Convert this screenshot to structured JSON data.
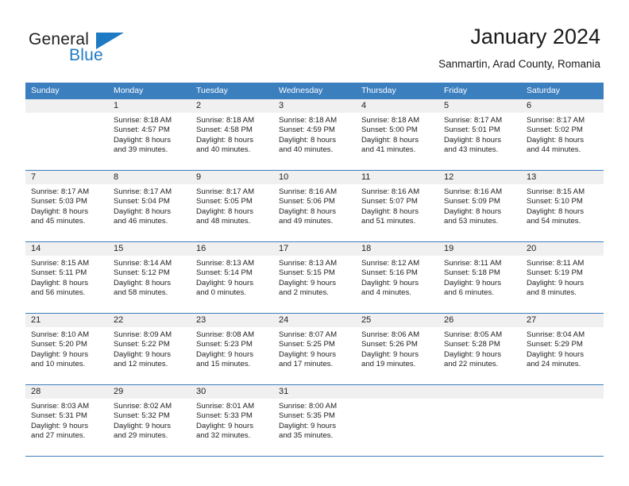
{
  "brand": {
    "name_part1": "General",
    "name_part2": "Blue"
  },
  "header": {
    "title": "January 2024",
    "subtitle": "Sanmartin, Arad County, Romania"
  },
  "colors": {
    "header_blue": "#3c7fbf",
    "brand_blue": "#1f7ac4",
    "daynum_band": "#f0f0f0",
    "text": "#222222"
  },
  "weekdays": [
    "Sunday",
    "Monday",
    "Tuesday",
    "Wednesday",
    "Thursday",
    "Friday",
    "Saturday"
  ],
  "weeks": [
    [
      {
        "day": "",
        "sunrise": "",
        "sunset": "",
        "daylight_line1": "",
        "daylight_line2": ""
      },
      {
        "day": "1",
        "sunrise": "Sunrise: 8:18 AM",
        "sunset": "Sunset: 4:57 PM",
        "daylight_line1": "Daylight: 8 hours",
        "daylight_line2": "and 39 minutes."
      },
      {
        "day": "2",
        "sunrise": "Sunrise: 8:18 AM",
        "sunset": "Sunset: 4:58 PM",
        "daylight_line1": "Daylight: 8 hours",
        "daylight_line2": "and 40 minutes."
      },
      {
        "day": "3",
        "sunrise": "Sunrise: 8:18 AM",
        "sunset": "Sunset: 4:59 PM",
        "daylight_line1": "Daylight: 8 hours",
        "daylight_line2": "and 40 minutes."
      },
      {
        "day": "4",
        "sunrise": "Sunrise: 8:18 AM",
        "sunset": "Sunset: 5:00 PM",
        "daylight_line1": "Daylight: 8 hours",
        "daylight_line2": "and 41 minutes."
      },
      {
        "day": "5",
        "sunrise": "Sunrise: 8:17 AM",
        "sunset": "Sunset: 5:01 PM",
        "daylight_line1": "Daylight: 8 hours",
        "daylight_line2": "and 43 minutes."
      },
      {
        "day": "6",
        "sunrise": "Sunrise: 8:17 AM",
        "sunset": "Sunset: 5:02 PM",
        "daylight_line1": "Daylight: 8 hours",
        "daylight_line2": "and 44 minutes."
      }
    ],
    [
      {
        "day": "7",
        "sunrise": "Sunrise: 8:17 AM",
        "sunset": "Sunset: 5:03 PM",
        "daylight_line1": "Daylight: 8 hours",
        "daylight_line2": "and 45 minutes."
      },
      {
        "day": "8",
        "sunrise": "Sunrise: 8:17 AM",
        "sunset": "Sunset: 5:04 PM",
        "daylight_line1": "Daylight: 8 hours",
        "daylight_line2": "and 46 minutes."
      },
      {
        "day": "9",
        "sunrise": "Sunrise: 8:17 AM",
        "sunset": "Sunset: 5:05 PM",
        "daylight_line1": "Daylight: 8 hours",
        "daylight_line2": "and 48 minutes."
      },
      {
        "day": "10",
        "sunrise": "Sunrise: 8:16 AM",
        "sunset": "Sunset: 5:06 PM",
        "daylight_line1": "Daylight: 8 hours",
        "daylight_line2": "and 49 minutes."
      },
      {
        "day": "11",
        "sunrise": "Sunrise: 8:16 AM",
        "sunset": "Sunset: 5:07 PM",
        "daylight_line1": "Daylight: 8 hours",
        "daylight_line2": "and 51 minutes."
      },
      {
        "day": "12",
        "sunrise": "Sunrise: 8:16 AM",
        "sunset": "Sunset: 5:09 PM",
        "daylight_line1": "Daylight: 8 hours",
        "daylight_line2": "and 53 minutes."
      },
      {
        "day": "13",
        "sunrise": "Sunrise: 8:15 AM",
        "sunset": "Sunset: 5:10 PM",
        "daylight_line1": "Daylight: 8 hours",
        "daylight_line2": "and 54 minutes."
      }
    ],
    [
      {
        "day": "14",
        "sunrise": "Sunrise: 8:15 AM",
        "sunset": "Sunset: 5:11 PM",
        "daylight_line1": "Daylight: 8 hours",
        "daylight_line2": "and 56 minutes."
      },
      {
        "day": "15",
        "sunrise": "Sunrise: 8:14 AM",
        "sunset": "Sunset: 5:12 PM",
        "daylight_line1": "Daylight: 8 hours",
        "daylight_line2": "and 58 minutes."
      },
      {
        "day": "16",
        "sunrise": "Sunrise: 8:13 AM",
        "sunset": "Sunset: 5:14 PM",
        "daylight_line1": "Daylight: 9 hours",
        "daylight_line2": "and 0 minutes."
      },
      {
        "day": "17",
        "sunrise": "Sunrise: 8:13 AM",
        "sunset": "Sunset: 5:15 PM",
        "daylight_line1": "Daylight: 9 hours",
        "daylight_line2": "and 2 minutes."
      },
      {
        "day": "18",
        "sunrise": "Sunrise: 8:12 AM",
        "sunset": "Sunset: 5:16 PM",
        "daylight_line1": "Daylight: 9 hours",
        "daylight_line2": "and 4 minutes."
      },
      {
        "day": "19",
        "sunrise": "Sunrise: 8:11 AM",
        "sunset": "Sunset: 5:18 PM",
        "daylight_line1": "Daylight: 9 hours",
        "daylight_line2": "and 6 minutes."
      },
      {
        "day": "20",
        "sunrise": "Sunrise: 8:11 AM",
        "sunset": "Sunset: 5:19 PM",
        "daylight_line1": "Daylight: 9 hours",
        "daylight_line2": "and 8 minutes."
      }
    ],
    [
      {
        "day": "21",
        "sunrise": "Sunrise: 8:10 AM",
        "sunset": "Sunset: 5:20 PM",
        "daylight_line1": "Daylight: 9 hours",
        "daylight_line2": "and 10 minutes."
      },
      {
        "day": "22",
        "sunrise": "Sunrise: 8:09 AM",
        "sunset": "Sunset: 5:22 PM",
        "daylight_line1": "Daylight: 9 hours",
        "daylight_line2": "and 12 minutes."
      },
      {
        "day": "23",
        "sunrise": "Sunrise: 8:08 AM",
        "sunset": "Sunset: 5:23 PM",
        "daylight_line1": "Daylight: 9 hours",
        "daylight_line2": "and 15 minutes."
      },
      {
        "day": "24",
        "sunrise": "Sunrise: 8:07 AM",
        "sunset": "Sunset: 5:25 PM",
        "daylight_line1": "Daylight: 9 hours",
        "daylight_line2": "and 17 minutes."
      },
      {
        "day": "25",
        "sunrise": "Sunrise: 8:06 AM",
        "sunset": "Sunset: 5:26 PM",
        "daylight_line1": "Daylight: 9 hours",
        "daylight_line2": "and 19 minutes."
      },
      {
        "day": "26",
        "sunrise": "Sunrise: 8:05 AM",
        "sunset": "Sunset: 5:28 PM",
        "daylight_line1": "Daylight: 9 hours",
        "daylight_line2": "and 22 minutes."
      },
      {
        "day": "27",
        "sunrise": "Sunrise: 8:04 AM",
        "sunset": "Sunset: 5:29 PM",
        "daylight_line1": "Daylight: 9 hours",
        "daylight_line2": "and 24 minutes."
      }
    ],
    [
      {
        "day": "28",
        "sunrise": "Sunrise: 8:03 AM",
        "sunset": "Sunset: 5:31 PM",
        "daylight_line1": "Daylight: 9 hours",
        "daylight_line2": "and 27 minutes."
      },
      {
        "day": "29",
        "sunrise": "Sunrise: 8:02 AM",
        "sunset": "Sunset: 5:32 PM",
        "daylight_line1": "Daylight: 9 hours",
        "daylight_line2": "and 29 minutes."
      },
      {
        "day": "30",
        "sunrise": "Sunrise: 8:01 AM",
        "sunset": "Sunset: 5:33 PM",
        "daylight_line1": "Daylight: 9 hours",
        "daylight_line2": "and 32 minutes."
      },
      {
        "day": "31",
        "sunrise": "Sunrise: 8:00 AM",
        "sunset": "Sunset: 5:35 PM",
        "daylight_line1": "Daylight: 9 hours",
        "daylight_line2": "and 35 minutes."
      },
      {
        "day": "",
        "sunrise": "",
        "sunset": "",
        "daylight_line1": "",
        "daylight_line2": ""
      },
      {
        "day": "",
        "sunrise": "",
        "sunset": "",
        "daylight_line1": "",
        "daylight_line2": ""
      },
      {
        "day": "",
        "sunrise": "",
        "sunset": "",
        "daylight_line1": "",
        "daylight_line2": ""
      }
    ]
  ]
}
